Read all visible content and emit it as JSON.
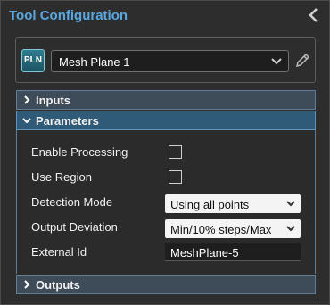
{
  "header": {
    "title": "Tool Configuration"
  },
  "tool": {
    "badge": "PLN",
    "selected": "Mesh Plane 1"
  },
  "sections": {
    "inputs": "Inputs",
    "parameters": "Parameters",
    "outputs": "Outputs"
  },
  "parameters": {
    "enable_processing": {
      "label": "Enable Processing",
      "checked": false
    },
    "use_region": {
      "label": "Use Region",
      "checked": false
    },
    "detection_mode": {
      "label": "Detection Mode",
      "value": "Using all points"
    },
    "output_deviation": {
      "label": "Output Deviation",
      "value": "Min/10% steps/Max"
    },
    "external_id": {
      "label": "External Id",
      "value": "MeshPlane-5"
    }
  },
  "colors": {
    "title": "#5aa7df",
    "section_active": "#2f5a78",
    "section": "#3e4c5a"
  },
  "icons": [
    "chevron-left-icon",
    "chevron-down-icon",
    "pencil-icon",
    "chevron-right-icon"
  ]
}
